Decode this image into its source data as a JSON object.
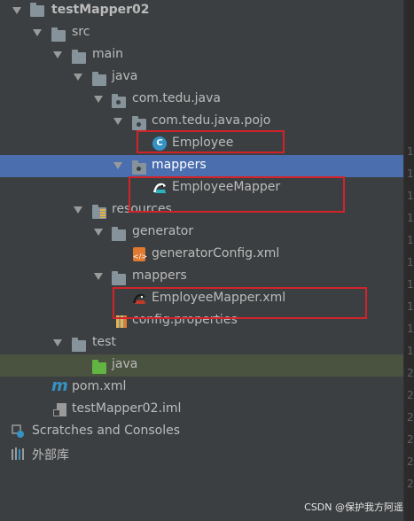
{
  "tree": {
    "project": "testMapper02",
    "src": "src",
    "main": "main",
    "java": "java",
    "package_root": "com.tedu.java",
    "package_pojo": "com.tedu.java.pojo",
    "employee_class": "Employee",
    "mappers_pkg": "mappers",
    "employee_mapper": "EmployeeMapper",
    "resources": "resources",
    "generator": "generator",
    "generator_config": "generatorConfig.xml",
    "mappers_res": "mappers",
    "employee_mapper_xml": "EmployeeMapper.xml",
    "config_properties": "config.properties",
    "test": "test",
    "test_java": "java",
    "pom": "pom.xml",
    "iml": "testMapper02.iml",
    "scratches": "Scratches and Consoles",
    "external_libs": "外部库"
  },
  "gutter_numbers": [
    "1",
    "1",
    "1",
    "1",
    "1",
    "1",
    "1",
    "1",
    "1",
    "1",
    "2",
    "2",
    "2",
    "2",
    "2",
    "2"
  ],
  "watermark": "CSDN @保护我方阿遥",
  "colors": {
    "selection": "#4b6eaf",
    "highlight_box": "#d2232a",
    "background": "#3c3f41"
  }
}
